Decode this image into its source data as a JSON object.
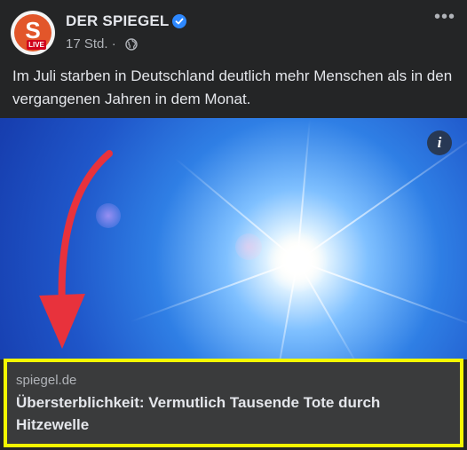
{
  "post": {
    "page_name": "DER SPIEGEL",
    "avatar_letter": "S",
    "avatar_badge": "LIVE",
    "timestamp": "17 Std. ·",
    "text": "Im Juli starben in Deutschland deutlich mehr Menschen als in den vergangenen Jahren in dem Monat.",
    "more_label": "•••",
    "info_label": "i"
  },
  "link_preview": {
    "domain": "spiegel.de",
    "title": "Übersterblichkeit: Vermutlich Tausende Tote durch Hitzewelle"
  },
  "colors": {
    "background": "#242526",
    "link_box_border": "#f3f800",
    "arrow": "#e8323c",
    "verified": "#2d88ff",
    "brand": "#e2562a"
  },
  "icons": [
    "verified-badge-icon",
    "globe-icon",
    "more-icon",
    "info-icon",
    "red-arrow-annotation"
  ]
}
